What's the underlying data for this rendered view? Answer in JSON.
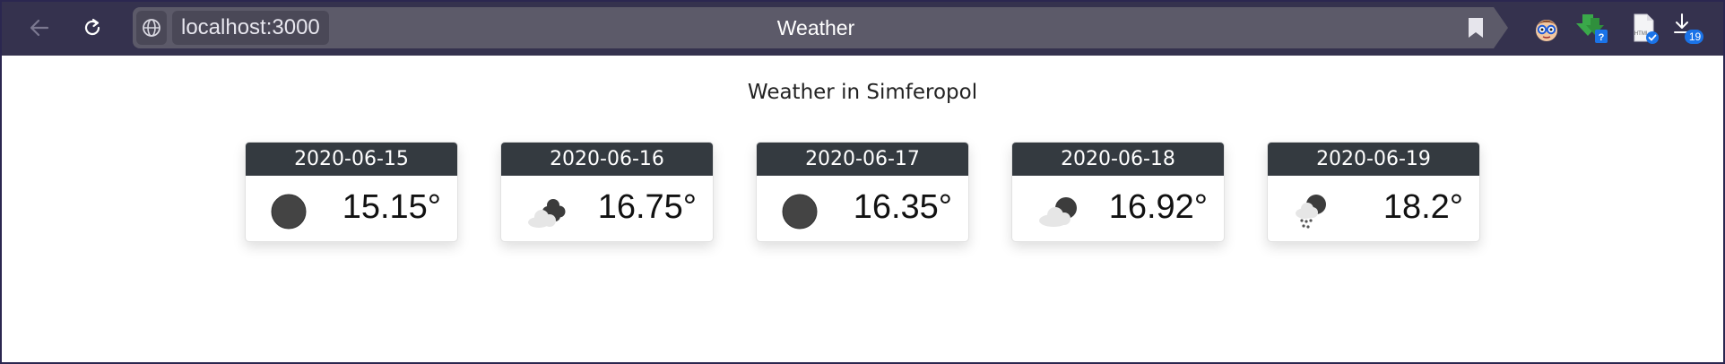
{
  "browser": {
    "url": "localhost:3000",
    "tab_title": "Weather",
    "downloads_badge": "19",
    "extensions": [
      "face-extension-icon",
      "download-helper-icon",
      "html-file-icon",
      "downloads-icon"
    ]
  },
  "page": {
    "heading": "Weather in Simferopol",
    "forecast": [
      {
        "date": "2020-06-15",
        "temp": "15.15°",
        "icon": "clear-night-icon"
      },
      {
        "date": "2020-06-16",
        "temp": "16.75°",
        "icon": "cloudy-icon"
      },
      {
        "date": "2020-06-17",
        "temp": "16.35°",
        "icon": "clear-night-icon"
      },
      {
        "date": "2020-06-18",
        "temp": "16.92°",
        "icon": "partly-cloudy-night-icon"
      },
      {
        "date": "2020-06-19",
        "temp": "18.2°",
        "icon": "rain-night-icon"
      }
    ]
  },
  "colors": {
    "toolbar": "#35324e",
    "card_header": "#343a40",
    "accent_badge": "#1a73e8"
  }
}
